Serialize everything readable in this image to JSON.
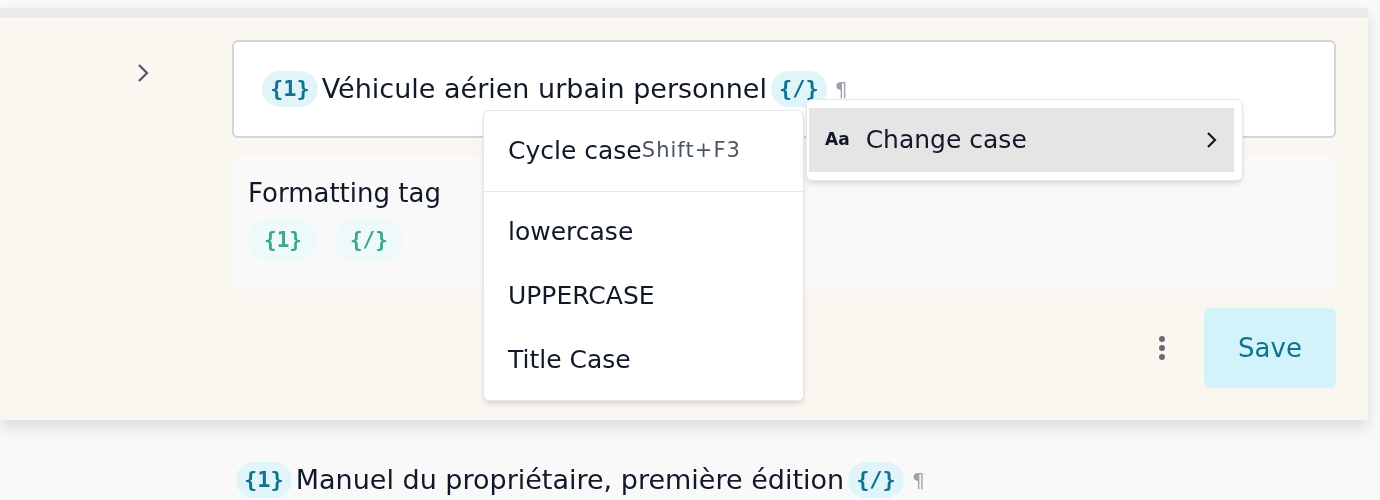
{
  "segment": {
    "expanded": false,
    "source": [
      {
        "kind": "tag",
        "text": "{1}"
      },
      {
        "kind": "text",
        "text": "Véhicule aérien urbain personnel"
      },
      {
        "kind": "tag",
        "text": "{/}"
      },
      {
        "kind": "mark",
        "text": "¶"
      }
    ],
    "formatting_tags": {
      "title": "Formatting tag",
      "tags": [
        "{1}",
        "{/}"
      ]
    },
    "save_button": "Save"
  },
  "context_menu": {
    "items": [
      {
        "kind": "shortcut",
        "label": "Cycle case",
        "shortcut": "Shift+F3"
      },
      {
        "kind": "divider"
      },
      {
        "kind": "item",
        "label": "lowercase"
      },
      {
        "kind": "item",
        "label": "UPPERCASE"
      },
      {
        "kind": "item",
        "label": "Title Case"
      }
    ]
  },
  "submenu": {
    "label": "Change case",
    "icon": "Aa",
    "selected": true
  },
  "next_segment": [
    {
      "kind": "tag",
      "text": "{1}"
    },
    {
      "kind": "text",
      "text": "Manuel du propriétaire, première édition"
    },
    {
      "kind": "tag",
      "text": "{/}"
    },
    {
      "kind": "mark",
      "text": "¶"
    }
  ]
}
